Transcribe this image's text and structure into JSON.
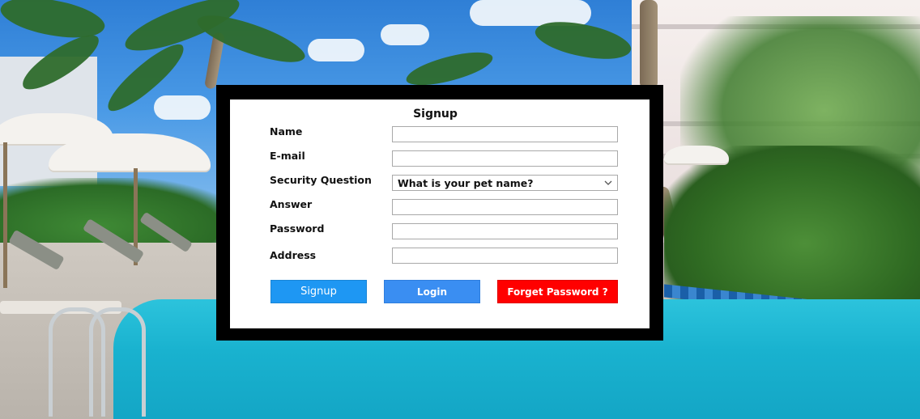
{
  "form": {
    "title": "Signup",
    "fields": [
      {
        "label": "Name",
        "value": ""
      },
      {
        "label": "E-mail",
        "value": ""
      },
      {
        "label": "Security Question",
        "value": "What is your pet name?"
      },
      {
        "label": "Answer",
        "value": ""
      },
      {
        "label": "Password",
        "value": ""
      },
      {
        "label": "Address",
        "value": ""
      }
    ],
    "buttons": {
      "signup": "Signup",
      "login": "Login",
      "forget_password": "Forget Password ?"
    }
  },
  "colors": {
    "signup_button": "#1e97f3",
    "login_button": "#3a8ef2",
    "forget_password_button": "#ff0000",
    "dialog_frame": "#000000",
    "dialog_panel": "#ffffff"
  },
  "icons": {
    "select_arrow": "chevron-down-icon"
  }
}
